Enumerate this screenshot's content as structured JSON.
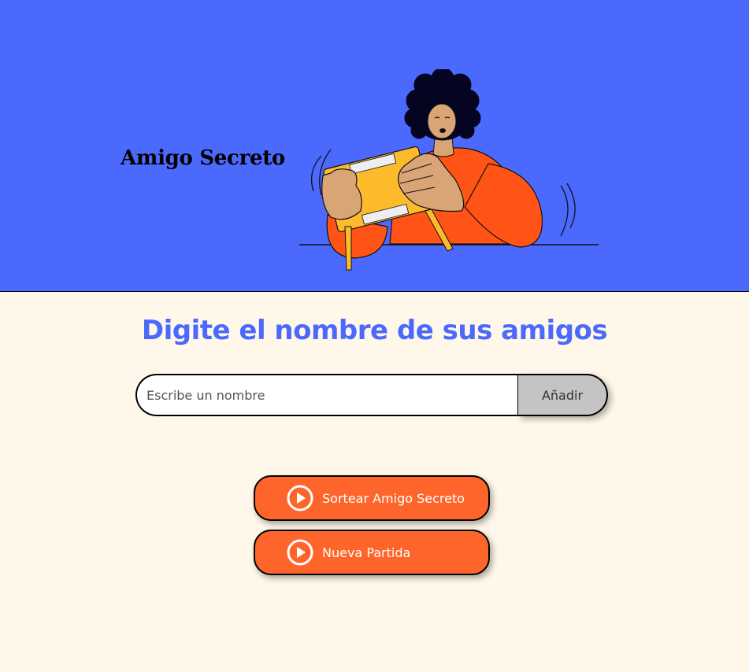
{
  "header": {
    "title": "Amigo Secreto",
    "background_color": "#4B69FD",
    "illustration": "person-holding-box-illustration"
  },
  "main": {
    "title": "Digite el nombre de sus amigos",
    "title_color": "#4B69FD",
    "background_color": "#FFF8EA"
  },
  "input_section": {
    "name_input": {
      "placeholder": "Escribe un nombre",
      "value": ""
    },
    "add_button_label": "Añadir",
    "add_button_color": "#C4C4C4"
  },
  "actions": {
    "draw_button_label": "Sortear Amigo Secreto",
    "new_game_button_label": "Nueva Partida",
    "button_color": "#FE652B",
    "button_icon": "play-circle-icon"
  }
}
